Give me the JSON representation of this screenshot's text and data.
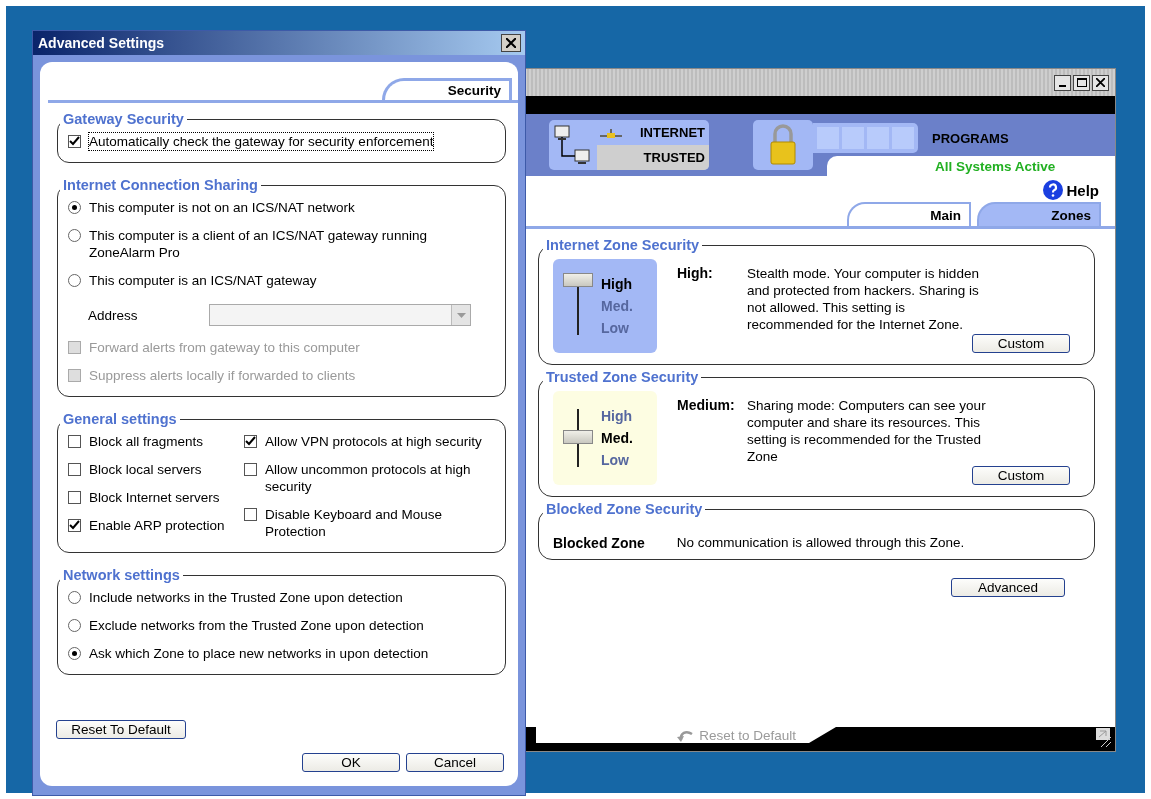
{
  "main_window": {
    "header": {
      "internet_label": "INTERNET",
      "trusted_label": "TRUSTED",
      "programs_label": "PROGRAMS",
      "system_status": "All Systems Active",
      "help": "Help"
    },
    "tabs": [
      {
        "label": "Main",
        "selected": true
      },
      {
        "label": "Zones",
        "selected": false
      }
    ],
    "zones": [
      {
        "kind": "slider",
        "title": "Internet Zone Security",
        "color": "#a3b8f5",
        "level": 1,
        "level_name": "High:",
        "description": "Stealth mode.  Your computer is hidden and protected from hackers.  Sharing is not allowed.  This setting is recommended for the Internet Zone.",
        "slider_labels": [
          {
            "label": "High",
            "selected": true
          },
          {
            "label": "Med.",
            "selected": false
          },
          {
            "label": "Low",
            "selected": false
          }
        ],
        "button": "Custom"
      },
      {
        "kind": "slider",
        "title": "Trusted Zone Security",
        "color": "#fdfde2",
        "level": 0.5,
        "level_name": "Medium:",
        "description": "Sharing mode:  Computers can see your computer and share its resources.  This setting is recommended for the Trusted Zone",
        "slider_labels": [
          {
            "label": "High",
            "selected": false
          },
          {
            "label": "Med.",
            "selected": true
          },
          {
            "label": "Low",
            "selected": false
          }
        ],
        "button": "Custom"
      },
      {
        "kind": "text",
        "title": "Blocked Zone Security",
        "level_name": "Blocked Zone",
        "description": "No communication is allowed through this Zone."
      }
    ],
    "advanced_button": "Advanced",
    "reset_link": "Reset to Default"
  },
  "dialog": {
    "title": "Advanced Settings",
    "tabs": [
      {
        "label": "Security",
        "selected": true
      }
    ],
    "groups": [
      {
        "title": "Gateway Security",
        "columns": [
          [
            {
              "kind": "checkbox",
              "label": "Automatically check the gateway for security enforcement",
              "checked": true,
              "disabled": false,
              "focused": true
            }
          ]
        ]
      },
      {
        "title": "Internet Connection Sharing",
        "columns": [
          [
            {
              "kind": "radio",
              "label": "This computer is not on an ICS/NAT network",
              "selected": true
            },
            {
              "kind": "radio",
              "label": "This computer is a client of an ICS/NAT gateway running ZoneAlarm Pro",
              "selected": false
            },
            {
              "kind": "radio",
              "label": "This computer is an ICS/NAT gateway",
              "selected": false
            },
            {
              "kind": "dropdown",
              "label": "Address",
              "disabled": true
            },
            {
              "kind": "checkbox",
              "label": "Forward alerts from gateway to this computer",
              "checked": false,
              "disabled": true,
              "focused": false
            },
            {
              "kind": "checkbox",
              "label": "Suppress alerts locally if forwarded to clients",
              "checked": false,
              "disabled": true,
              "focused": false
            }
          ]
        ]
      },
      {
        "title": "General settings",
        "columns": [
          [
            {
              "kind": "checkbox",
              "label": "Block all fragments",
              "checked": false,
              "disabled": false,
              "focused": false
            },
            {
              "kind": "checkbox",
              "label": "Block local servers",
              "checked": false,
              "disabled": false,
              "focused": false
            },
            {
              "kind": "checkbox",
              "label": "Block Internet servers",
              "checked": false,
              "disabled": false,
              "focused": false
            },
            {
              "kind": "checkbox",
              "label": "Enable ARP protection",
              "checked": true,
              "disabled": false,
              "focused": false
            }
          ],
          [
            {
              "kind": "checkbox",
              "label": "Allow VPN protocols at high security",
              "checked": true,
              "disabled": false,
              "focused": false
            },
            {
              "kind": "checkbox",
              "label": "Allow uncommon protocols at high security",
              "checked": false,
              "disabled": false,
              "focused": false
            },
            {
              "kind": "checkbox",
              "label": "Disable Keyboard and Mouse Protection",
              "checked": false,
              "disabled": false,
              "focused": false
            }
          ]
        ]
      },
      {
        "title": "Network settings",
        "columns": [
          [
            {
              "kind": "radio",
              "label": "Include networks in the Trusted Zone upon detection",
              "selected": false
            },
            {
              "kind": "radio",
              "label": "Exclude networks from the Trusted Zone upon detection",
              "selected": false
            },
            {
              "kind": "radio",
              "label": "Ask which Zone to place new networks in upon detection",
              "selected": true
            }
          ]
        ]
      }
    ],
    "reset_button": "Reset To Default",
    "buttons": [
      "OK",
      "Cancel"
    ]
  }
}
